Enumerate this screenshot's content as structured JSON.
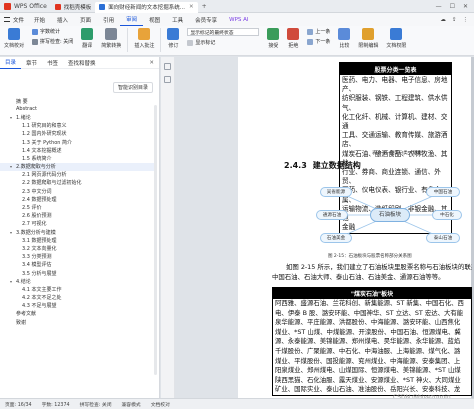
{
  "tabbar": {
    "app": "WPS Office",
    "tabs": [
      {
        "label": "找稻壳模板",
        "color": "#e0341f"
      },
      {
        "label": "面向财经新闻的文本挖掘系统...",
        "color": "#2b6fd6"
      }
    ],
    "plus": "+"
  },
  "menu": {
    "file": "文件",
    "items": [
      "开始",
      "插入",
      "页面",
      "引用",
      "审阅",
      "视图",
      "工具",
      "会员专享"
    ],
    "active": "审阅",
    "ai": "WPS AI"
  },
  "ribbon": {
    "groups": [
      {
        "label": "文档校对",
        "color": "#3a7bd5"
      },
      {
        "label": "字数统计",
        "color": "#5b8bd9"
      },
      {
        "label": "翻译",
        "color": "#2d9c6b"
      },
      {
        "label": "简繁转换",
        "color": "#7c8796"
      },
      {
        "label": "插入批注",
        "color": "#e8a33a"
      },
      {
        "label": "修订",
        "color": "#3a7bd5"
      }
    ],
    "display_select": "显示标记的最终状态",
    "display_markup": "显示标记",
    "review_pane": "审阅",
    "accept": "接受",
    "reject": "拒绝",
    "prev": "上一条",
    "next": "下一条",
    "compare": "比较",
    "restrict": "限制编辑",
    "protect": "文档权限",
    "doc_verify": "文档认证"
  },
  "leftpane": {
    "tabs": [
      "目录",
      "章节",
      "书签",
      "查找和替换"
    ],
    "active": "目录",
    "smart_btn": "智能识别目录",
    "toc": [
      {
        "label": "摘 要",
        "level": 1
      },
      {
        "label": "Abstract",
        "level": 1
      },
      {
        "label": "1.绪论",
        "level": 1,
        "tri": "▾"
      },
      {
        "label": "1.1 研究目的和意义",
        "level": 2
      },
      {
        "label": "1.2 国内外研究现状",
        "level": 2
      },
      {
        "label": "1.3 关于 Python 简介",
        "level": 2
      },
      {
        "label": "1.4 文本挖掘概述",
        "level": 2
      },
      {
        "label": "1.5 系统简介",
        "level": 2
      },
      {
        "label": "2.数据爬取与分析",
        "level": 1,
        "tri": "▾",
        "selected": true
      },
      {
        "label": "2.1 网页源代码分析",
        "level": 2
      },
      {
        "label": "2.2 数据爬取与过滤初始化",
        "level": 2
      },
      {
        "label": "2.3 中文分词",
        "level": 2
      },
      {
        "label": "2.4 数据预处理",
        "level": 2
      },
      {
        "label": "2.5 评价",
        "level": 2
      },
      {
        "label": "2.6 股价预测",
        "level": 2
      },
      {
        "label": "2.7 可视化",
        "level": 2
      },
      {
        "label": "3.数据分析与建模",
        "level": 1,
        "tri": "▾"
      },
      {
        "label": "3.1 数据预处理",
        "level": 2
      },
      {
        "label": "3.2 文本向量化",
        "level": 2
      },
      {
        "label": "3.3 分类预测",
        "level": 2
      },
      {
        "label": "3.4 模型评估",
        "level": 2
      },
      {
        "label": "3.5 分析与展望",
        "level": 2
      },
      {
        "label": "4.结论",
        "level": 1,
        "tri": "▾"
      },
      {
        "label": "4.1 本文主要工作",
        "level": 2
      },
      {
        "label": "4.2 本文不足之处",
        "level": 2
      },
      {
        "label": "4.3 不足与展望",
        "level": 2
      },
      {
        "label": "参考文献",
        "level": 1
      },
      {
        "label": "致谢",
        "level": 1
      }
    ]
  },
  "document": {
    "table1": {
      "header": "股票分类一览表",
      "lines": [
        "医药、电力、电器、电子信息、房地产、",
        "纺织服装、钢铁、工程建筑、供水供气、",
        "化工化纤、机械、计算机、建材、交通",
        "工具、交通运输、教育传媒、旅游酒店、",
        "煤炭石油、酿酒食品、农林牧渔、其他",
        "行业、券商、商业连锁、通信、外贸、",
        "医药、仪电仪表、银行业、有色金属、",
        "运输物流、造纸印刷、非银金融、其他",
        "金融"
      ]
    },
    "caption1": "表 2-4：股票分类一览表",
    "heading_num": "2.4.3",
    "heading_text": "建立数据结构",
    "diagram": {
      "center": "石油板块",
      "nodes": [
        "吴省能源",
        "中国石油",
        "通源石油",
        "中石化",
        "石油美金",
        "泰山石油"
      ]
    },
    "caption2": "图 2-15：石油板块与股票名称部分关系图",
    "para": [
      "如图 2-15 所示，我们建立了石油板块里股票名称与石油板块的联系，",
      "中国石油、石油大师、泰山石油、石油美金、通源石油等等。"
    ],
    "table2": {
      "header": "\"煤炭石油\"板块",
      "lines": [
        "阿西雅、盛源石油、兰花科创、新集能源、ST 新集、中国石化、西",
        "电、伊泰 B 股、潞安环能、中国神华、ST 立达、ST 宏达、大有能",
        "泉华能源、平庄能源、洪都股份、中海能源、潞安环能、山西焦化",
        "煤业、*ST 山煤、中煤能源、开滦股份、中国石油、恒源煤电、冀",
        "源、永泰能源、美锦能源、郑州煤电、昊华能源、永华能源、蓝焰",
        "千煤股份、广聚能源、中石化、中海油服、上海能源、煤气化、潞",
        "煤业、平煤股份、国投能源、兖州煤业、中海能源、安泰集团、上",
        "阳泉煤业、郑州煤电、山煤国际、恒源煤电、美锦能源、*ST 山煤",
        "陕西黑猫、石化油服、露天煤业、安源煤业、*ST 神火、大同煤业",
        "矿业、国际实业、泰山石油、准油股份、岳阳兴长、安泰科技、龙"
      ]
    }
  },
  "status": {
    "page": "页面: 16/34",
    "words": "字数: 12374",
    "spell": "拼写检查: 关闭",
    "compat": "兼容模式",
    "docverify": "文档校对"
  },
  "watermark": "CSDN @biyezuopin"
}
